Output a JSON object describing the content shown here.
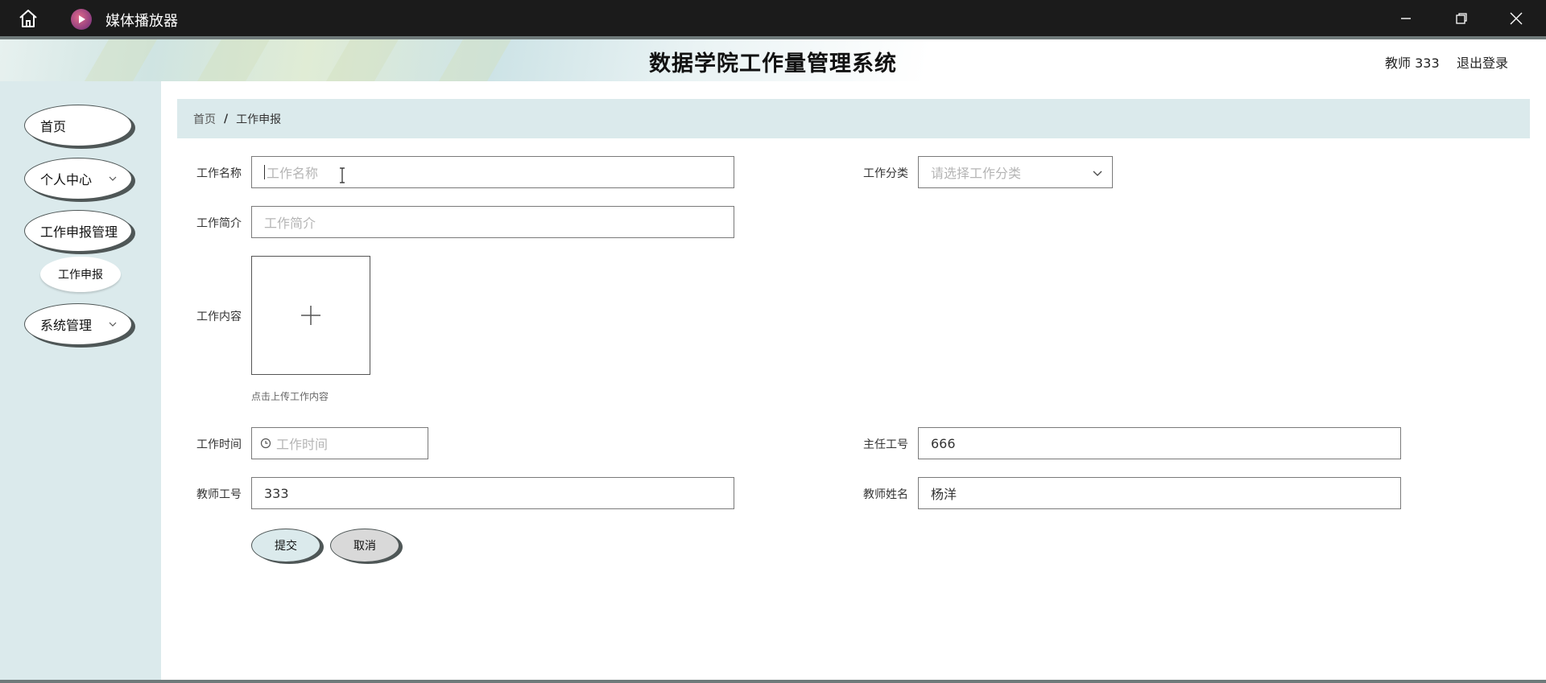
{
  "window": {
    "app_title": "媒体播放器"
  },
  "header": {
    "system_title": "数据学院工作量管理系统",
    "user_label": "教师 333",
    "logout_label": "退出登录"
  },
  "sidebar": {
    "items": [
      {
        "label": "首页",
        "has_children": false
      },
      {
        "label": "个人中心",
        "has_children": true
      },
      {
        "label": "工作申报管理",
        "has_children": false
      },
      {
        "label": "系统管理",
        "has_children": true
      }
    ],
    "sub_items": [
      {
        "label": "工作申报",
        "parent": "工作申报管理"
      }
    ]
  },
  "breadcrumb": {
    "home": "首页",
    "separator": "/",
    "current": "工作申报"
  },
  "form": {
    "work_name": {
      "label": "工作名称",
      "value": "",
      "placeholder": "工作名称"
    },
    "work_category": {
      "label": "工作分类",
      "value": "",
      "placeholder": "请选择工作分类"
    },
    "work_intro": {
      "label": "工作简介",
      "value": "",
      "placeholder": "工作简介"
    },
    "work_content": {
      "label": "工作内容",
      "upload_hint": "点击上传工作内容"
    },
    "work_time": {
      "label": "工作时间",
      "value": "",
      "placeholder": "工作时间"
    },
    "director_id": {
      "label": "主任工号",
      "value": "666"
    },
    "teacher_id": {
      "label": "教师工号",
      "value": "333"
    },
    "teacher_name": {
      "label": "教师姓名",
      "value": "杨洋"
    },
    "submit_label": "提交",
    "cancel_label": "取消"
  },
  "colors": {
    "sidebar_bg": "#dbeaec",
    "titlebar_bg": "#1b1b1b",
    "pill_border": "#4f5757",
    "cancel_bg": "#d9d9d9"
  }
}
